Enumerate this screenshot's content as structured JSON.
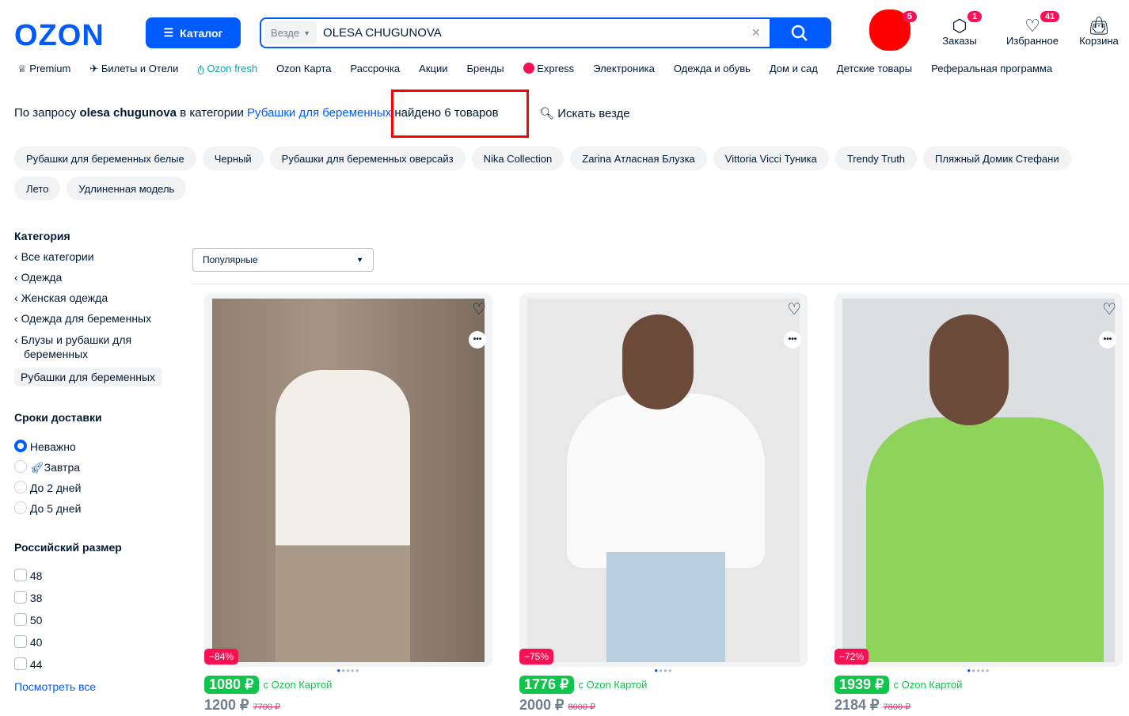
{
  "header": {
    "logo": "OZON",
    "catalog": "Каталог",
    "search_scope": "Везде",
    "search_value": "OLESA CHUGUNOVA",
    "icons": [
      {
        "label": "Заказы",
        "badge": "1"
      },
      {
        "label": "Избранное",
        "badge": "41"
      },
      {
        "label": "Корзина"
      }
    ],
    "profile_badge": "5"
  },
  "nav": [
    "Premium",
    "Билеты и Отели",
    "Ozon fresh",
    "Ozon Карта",
    "Рассрочка",
    "Акции",
    "Бренды",
    "Express",
    "Электроника",
    "Одежда и обувь",
    "Дом и сад",
    "Детские товары",
    "Реферальная программа"
  ],
  "query": {
    "pre": "По запросу ",
    "term": "olesa chugunova",
    "mid": " в категории ",
    "category": "Рубашки для беременных",
    "found": " найдено 6 товаров",
    "search_everywhere": "Искать везде"
  },
  "chips": [
    "Рубашки для беременных белые",
    "Черный",
    "Рубашки для беременных оверсайз",
    "Nika Collection",
    "Zarina Атласная Блузка",
    "Vittoria Vicci Туника",
    "Trendy Truth",
    "Пляжный Домик Стефани",
    "Лето",
    "Удлиненная модель"
  ],
  "sidebar": {
    "category_title": "Категория",
    "categories": [
      "Все категории",
      "Одежда",
      "Женская одежда",
      "Одежда для беременных",
      "Блузы и рубашки для беременных"
    ],
    "active_category": "Рубашки для беременных",
    "delivery_title": "Сроки доставки",
    "delivery": [
      "Неважно",
      "Завтра",
      "До 2 дней",
      "До 5 дней"
    ],
    "size_title": "Российский размер",
    "sizes": [
      "48",
      "38",
      "50",
      "40",
      "44"
    ],
    "see_all": "Посмотреть все"
  },
  "sort": "Популярные",
  "products": [
    {
      "discount": "−84%",
      "card_price": "1080 ₽",
      "card_label": "с Ozon Картой",
      "price": "1200 ₽",
      "old_price": "7700 ₽",
      "color": "#8a7b6c"
    },
    {
      "discount": "−75%",
      "card_price": "1776 ₽",
      "card_label": "с Ozon Картой",
      "price": "2000 ₽",
      "old_price": "8000 ₽",
      "color": "#e6e6e6"
    },
    {
      "discount": "−72%",
      "card_price": "1939 ₽",
      "card_label": "с Ozon Картой",
      "price": "2184 ₽",
      "old_price": "7800 ₽",
      "color": "#d9dcdf"
    }
  ]
}
